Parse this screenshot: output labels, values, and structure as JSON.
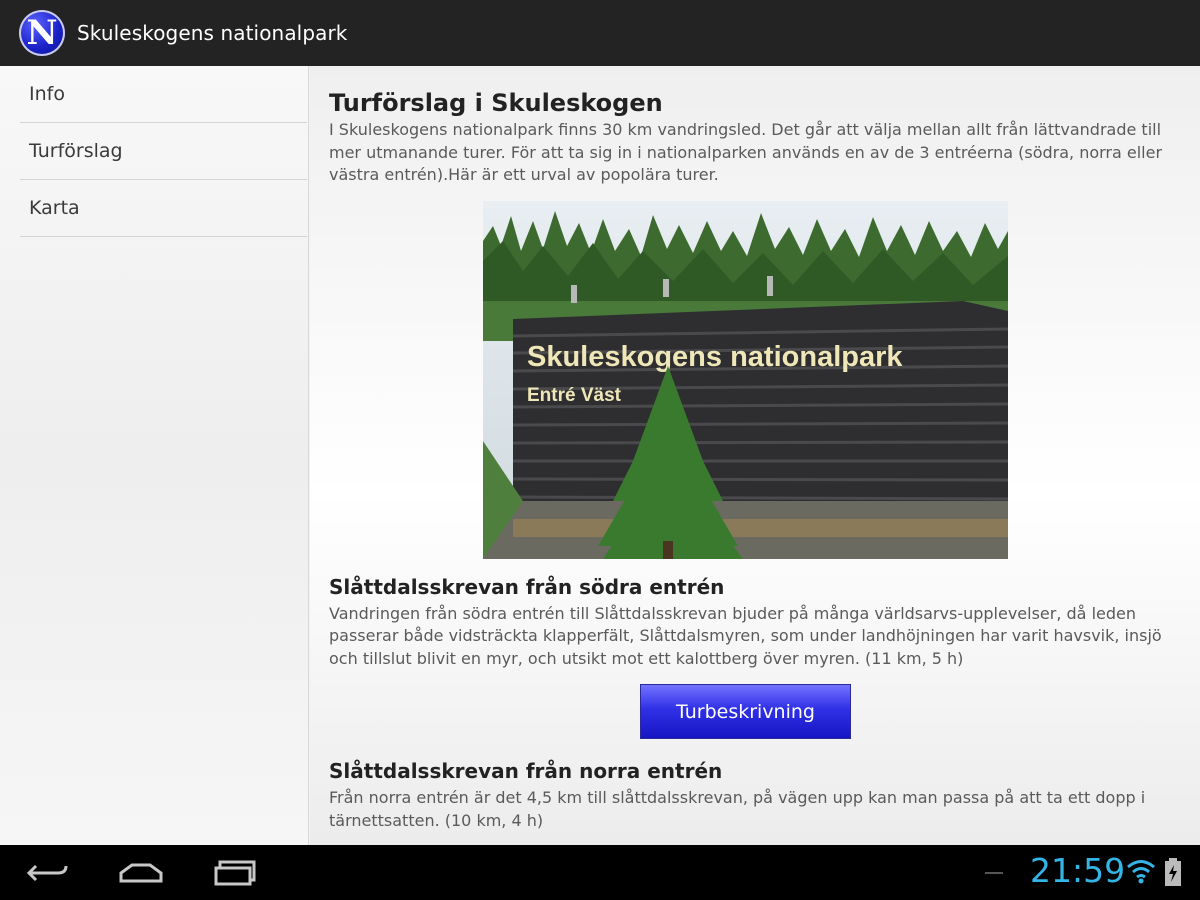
{
  "app": {
    "title": "Skuleskogens nationalpark",
    "logo_letter": "N"
  },
  "sidebar": {
    "items": [
      {
        "label": "Info"
      },
      {
        "label": "Turförslag"
      },
      {
        "label": "Karta"
      }
    ]
  },
  "main": {
    "title": "Turförslag i Skuleskogen",
    "intro": "I Skuleskogens nationalpark finns 30 km vandringsled. Det går att välja mellan allt från lättvandrade till mer utmanande turer. För att ta sig in i nationalparken används en av de 3 entréerna (södra, norra eller västra entrén).Här är ett urval av popolära turer.",
    "image": {
      "sign_line1": "Skuleskogens nationalpark",
      "sign_line2": "Entré Väst"
    },
    "sections": [
      {
        "title": "Slåttdalsskrevan från södra entrén",
        "text": "Vandringen från södra entrén till Slåttdalsskrevan bjuder på många världsarvs-upplevelser, då leden passerar både vidsträckta klapperfält, Slåttdalsmyren, som under landhöjningen har varit havsvik, insjö och tillslut blivit en myr, och utsikt mot ett kalottberg över myren. (11 km, 5 h)",
        "button_label": "Turbeskrivning"
      },
      {
        "title": "Slåttdalsskrevan från norra entrén",
        "text": "Från norra entrén är det 4,5 km till slåttdalsskrevan, på vägen upp kan man passa på att ta ett dopp i tärnettsatten. (10 km, 4 h)"
      }
    ]
  },
  "system_bar": {
    "clock": "21:59",
    "icons": [
      "back-icon",
      "home-icon",
      "recent-apps-icon",
      "wifi-icon",
      "battery-charging-icon"
    ],
    "accent_color": "#33b5e5"
  }
}
